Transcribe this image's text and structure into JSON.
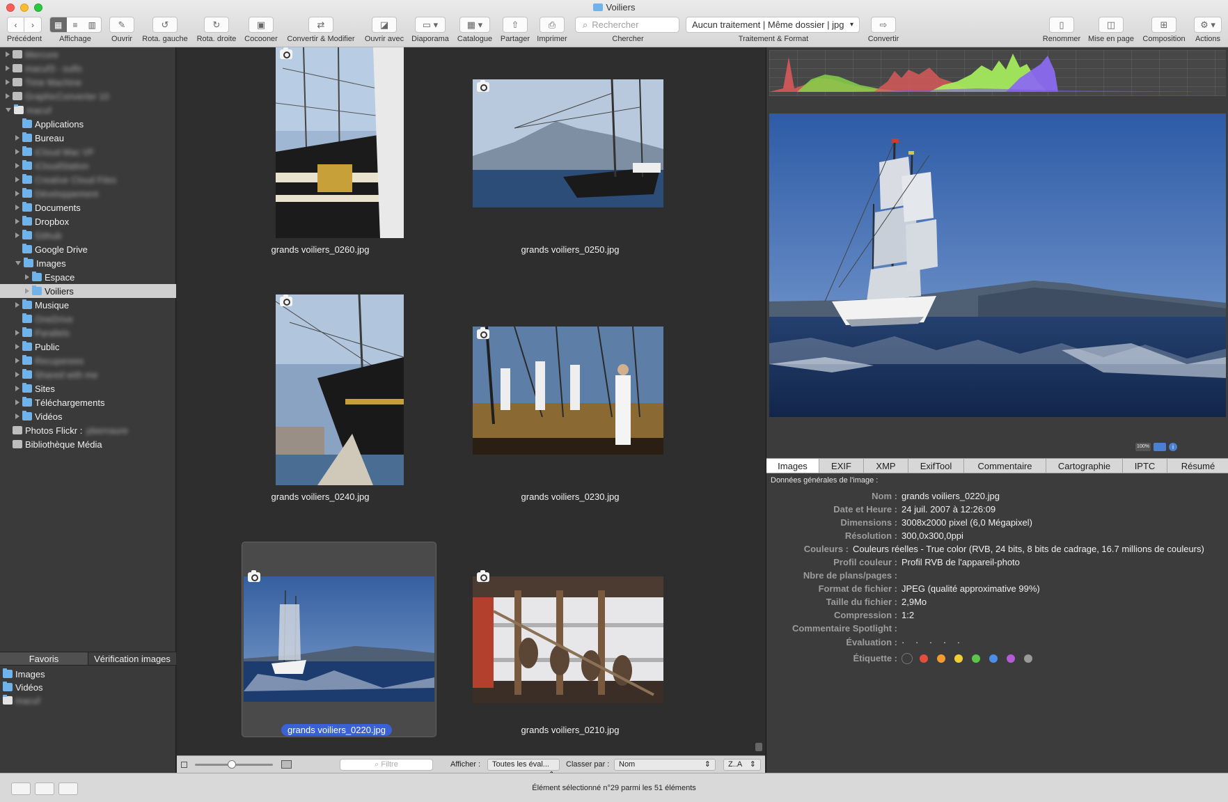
{
  "window": {
    "title": "Voiliers"
  },
  "toolbar": {
    "back_label": "Précédent",
    "view_label": "Affichage",
    "open_label": "Ouvrir",
    "rot_left_label": "Rota. gauche",
    "rot_right_label": "Rota. droite",
    "cocoon_label": "Cocooner",
    "convert_modify_label": "Convertir & Modifier",
    "open_with_label": "Ouvrir avec",
    "slideshow_label": "Diaporama",
    "catalog_label": "Catalogue",
    "share_label": "Partager",
    "print_label": "Imprimer",
    "search_placeholder": "Rechercher",
    "search_label": "Chercher",
    "processing_value": "Aucun traitement | Même dossier | jpg",
    "processing_label": "Traitement & Format",
    "convert_label": "Convertir",
    "rename_label": "Renommer",
    "layout_label": "Mise en page",
    "composition_label": "Composition",
    "actions_label": "Actions"
  },
  "sidebar": {
    "tree": [
      {
        "label": "Mercure",
        "blur": true
      },
      {
        "label": "macuf3 - sulfo",
        "blur": true
      },
      {
        "label": "Time Machine",
        "blur": true
      },
      {
        "label": "GraphicConverter 10",
        "blur": true
      },
      {
        "label": "macuf",
        "blur": true
      },
      {
        "label": "Applications"
      },
      {
        "label": "Bureau"
      },
      {
        "label": "iCloud Mac VF",
        "blur": true
      },
      {
        "label": "iCloudStation",
        "blur": true
      },
      {
        "label": "Creative Cloud Files",
        "blur": true
      },
      {
        "label": "Développement",
        "blur": true
      },
      {
        "label": "Documents"
      },
      {
        "label": "Dropbox"
      },
      {
        "label": "Github",
        "blur": true
      },
      {
        "label": "Google Drive"
      },
      {
        "label": "Images"
      },
      {
        "label": "Espace"
      },
      {
        "label": "Voiliers"
      },
      {
        "label": "Musique"
      },
      {
        "label": "OneDrive",
        "blur": true
      },
      {
        "label": "Parallels",
        "blur": true
      },
      {
        "label": "Public"
      },
      {
        "label": "Recuperees",
        "blur": true
      },
      {
        "label": "Shared with me",
        "blur": true
      },
      {
        "label": "Sites"
      },
      {
        "label": "Téléchargements"
      },
      {
        "label": "Vidéos"
      },
      {
        "label": "Photos Flickr :"
      },
      {
        "label": "Bibliothèque Média"
      }
    ],
    "flickr_user": "pbernaure",
    "tabs": [
      "Favoris",
      "Vérification images"
    ],
    "favorites": [
      {
        "label": "Images"
      },
      {
        "label": "Vidéos"
      },
      {
        "label": "macuf",
        "blur": true
      }
    ]
  },
  "browser": {
    "thumbnails": [
      {
        "name": "grands voiliers_0260.jpg"
      },
      {
        "name": "grands voiliers_0250.jpg"
      },
      {
        "name": "grands voiliers_0240.jpg"
      },
      {
        "name": "grands voiliers_0230.jpg"
      },
      {
        "name": "grands voiliers_0220.jpg",
        "selected": true
      },
      {
        "name": "grands voiliers_0210.jpg"
      }
    ],
    "filter_placeholder": "Filtre",
    "show_label": "Afficher :",
    "show_value": "Toutes les éval...",
    "sort_label": "Classer par :",
    "sort_value": "Nom",
    "order_value": "Z..A"
  },
  "preview": {
    "zoom": "100%",
    "tabs": [
      "Images",
      "EXIF",
      "XMP",
      "ExifTool",
      "Commentaire",
      "Cartographie",
      "IPTC",
      "Résumé"
    ],
    "active_tab": "Images",
    "header": "Données générales de l'image :",
    "info": [
      {
        "key": "Nom :",
        "value": "grands voiliers_0220.jpg"
      },
      {
        "key": "Date et Heure :",
        "value": "24 juil. 2007 à 12:26:09"
      },
      {
        "key": "Dimensions :",
        "value": "3008x2000 pixel (6,0 Mégapixel)"
      },
      {
        "key": "Résolution :",
        "value": "300,0x300,0ppi"
      },
      {
        "key": "Couleurs :",
        "value": "Couleurs réelles - True color (RVB, 24 bits, 8 bits de cadrage, 16.7 millions de couleurs)"
      },
      {
        "key": "Profil couleur :",
        "value": "Profil RVB de l'appareil-photo"
      },
      {
        "key": "Nbre de plans/pages :",
        "value": ""
      },
      {
        "key": "Format de fichier :",
        "value": "JPEG (qualité approximative 99%)"
      },
      {
        "key": "Taille du fichier :",
        "value": "2,9Mo"
      },
      {
        "key": "Compression :",
        "value": "1:2"
      },
      {
        "key": "Commentaire Spotlight :",
        "value": ""
      },
      {
        "key": "Évaluation :",
        "value": "· · · · ·"
      },
      {
        "key": "Étiquette :",
        "value": ""
      }
    ],
    "label_colors": [
      "#e74c3c",
      "#f39c2e",
      "#f1cf32",
      "#5cc64a",
      "#4a90e8",
      "#b65bd6",
      "#9a9a9a"
    ]
  },
  "status": {
    "text": "Élément sélectionné n°29 parmi les 51 éléments"
  }
}
